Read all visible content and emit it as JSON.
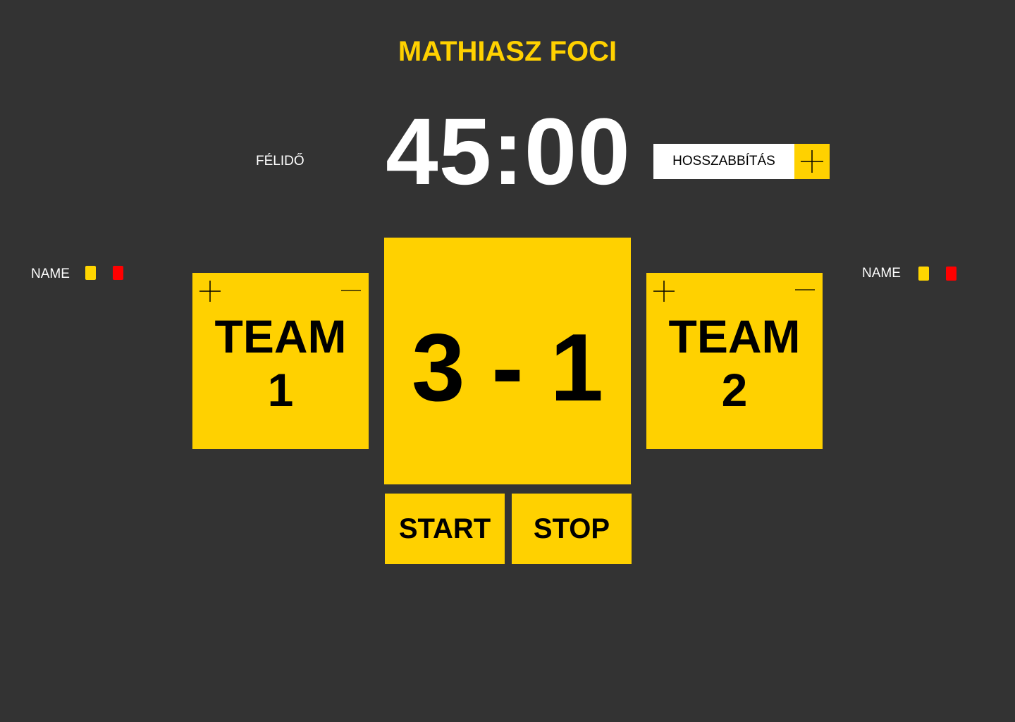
{
  "app": {
    "title": "MATHIASZ FOCI"
  },
  "timer": {
    "half_label": "FÉLIDŐ",
    "clock": "45:00",
    "extra_time_label": "HOSSZABBÍTÁS",
    "add_icon": "plus-icon"
  },
  "players": {
    "left": {
      "name": "NAME"
    },
    "right": {
      "name": "NAME"
    }
  },
  "cards": {
    "yellow_color": "#FFD500",
    "red_color": "#FF0000"
  },
  "teams": {
    "home": {
      "name": "TEAM\n1",
      "add_icon": "plus-icon",
      "remove_icon": "minus-icon"
    },
    "away": {
      "name": "TEAM\n2",
      "add_icon": "plus-icon",
      "remove_icon": "minus-icon"
    }
  },
  "score": {
    "display": "3 - 1",
    "home": 3,
    "away": 1
  },
  "controls": {
    "start_label": "START",
    "stop_label": "STOP"
  },
  "colors": {
    "background": "#333333",
    "accent": "#FFD100",
    "text_light": "#FFFFFF",
    "text_dark": "#000000"
  }
}
